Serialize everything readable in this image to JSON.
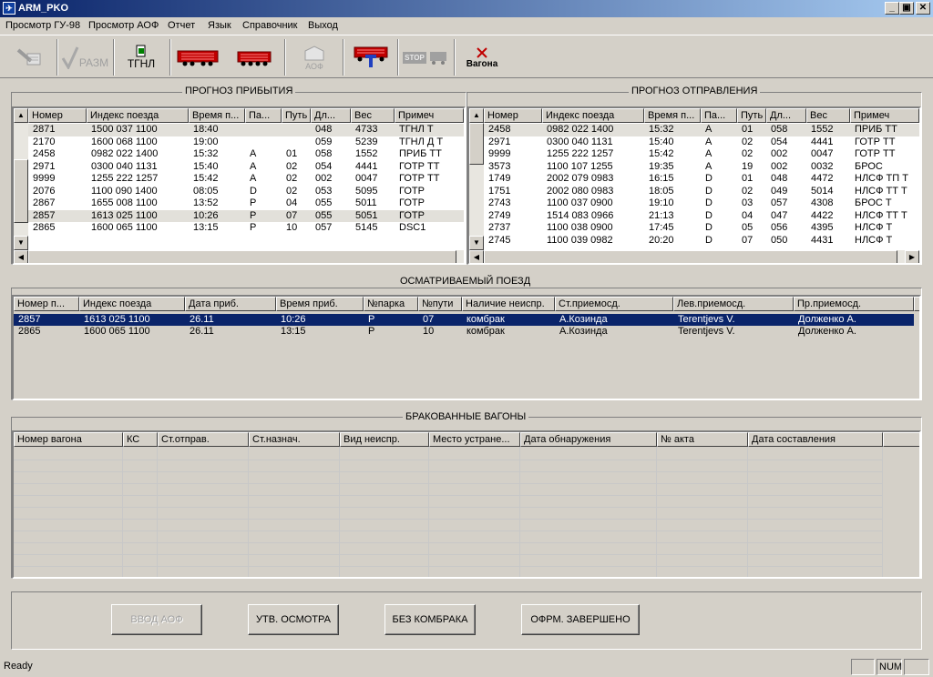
{
  "window": {
    "title": "ARM_PKO",
    "min": "_",
    "max": "▣",
    "close": "✕"
  },
  "menu": [
    "Просмотр ГУ-98",
    "Просмотр АОФ",
    "Отчет",
    "Язык",
    "Справочник",
    "Выход"
  ],
  "toolbar": {
    "razm_label": "РАЗМ",
    "tgnl_label": "ТГНЛ",
    "aof_label": "АОФ",
    "stop_label": "STOP",
    "vagona_label": "Вагона"
  },
  "arrival": {
    "title": "ПРОГНОЗ ПРИБЫТИЯ",
    "headers": [
      "Номер",
      "Индекс поезда",
      "Время п...",
      "Па...",
      "Путь",
      "Дл...",
      "Вес",
      "Примеч"
    ],
    "rows": [
      [
        "2871",
        "1500 037 1100",
        "18:40",
        "",
        "",
        "048",
        "4733",
        "ТГНЛ    Т"
      ],
      [
        "2170",
        "1600 068 1100",
        "19:00",
        "",
        "",
        "059",
        "5239",
        "ТГНЛ    Д Т"
      ],
      [
        "2458",
        "0982 022 1400",
        "15:32",
        "A",
        "01",
        "058",
        "1552",
        "ПРИБ ТТ"
      ],
      [
        "2971",
        "0300 040 1131",
        "15:40",
        "A",
        "02",
        "054",
        "4441",
        "ГОТР ТТ"
      ],
      [
        "9999",
        "1255 222 1257",
        "15:42",
        "A",
        "02",
        "002",
        "0047",
        "ГОТР ТТ"
      ],
      [
        "2076",
        "1100 090 1400",
        "08:05",
        "D",
        "02",
        "053",
        "5095",
        "ГОТР"
      ],
      [
        "2867",
        "1655 008 1100",
        "13:52",
        "P",
        "04",
        "055",
        "5011",
        "ГОТР"
      ],
      [
        "2857",
        "1613 025 1100",
        "10:26",
        "P",
        "07",
        "055",
        "5051",
        "ГОТР"
      ],
      [
        "2865",
        "1600 065 1100",
        "13:15",
        "P",
        "10",
        "057",
        "5145",
        "DSC1"
      ]
    ]
  },
  "departure": {
    "title": "ПРОГНОЗ ОТПРАВЛЕНИЯ",
    "headers": [
      "Номер",
      "Индекс поезда",
      "Время п...",
      "Па...",
      "Путь",
      "Дл...",
      "Вес",
      "Примеч"
    ],
    "rows": [
      [
        "2458",
        "0982 022 1400",
        "15:32",
        "A",
        "01",
        "058",
        "1552",
        "ПРИБ ТТ"
      ],
      [
        "2971",
        "0300 040 1131",
        "15:40",
        "A",
        "02",
        "054",
        "4441",
        "ГОТР ТТ"
      ],
      [
        "9999",
        "1255 222 1257",
        "15:42",
        "A",
        "02",
        "002",
        "0047",
        "ГОТР ТТ"
      ],
      [
        "3573",
        "1100 107 1255",
        "19:35",
        "A",
        "19",
        "002",
        "0032",
        "БРОС"
      ],
      [
        "1749",
        "2002 079 0983",
        "16:15",
        "D",
        "01",
        "048",
        "4472",
        "НЛСФ ТП Т"
      ],
      [
        "1751",
        "2002 080 0983",
        "18:05",
        "D",
        "02",
        "049",
        "5014",
        "НЛСФ ТТ Т"
      ],
      [
        "2743",
        "1100 037 0900",
        "19:10",
        "D",
        "03",
        "057",
        "4308",
        "БРОС    Т"
      ],
      [
        "2749",
        "1514 083 0966",
        "21:13",
        "D",
        "04",
        "047",
        "4422",
        "НЛСФ ТТ Т"
      ],
      [
        "2737",
        "1100 038 0900",
        "17:45",
        "D",
        "05",
        "056",
        "4395",
        "НЛСФ    Т"
      ],
      [
        "2745",
        "1100 039 0982",
        "20:20",
        "D",
        "07",
        "050",
        "4431",
        "НЛСФ    Т"
      ]
    ]
  },
  "inspected": {
    "title": "ОСМАТРИВАЕМЫЙ ПОЕЗД",
    "headers": [
      "Номер п...",
      "Индекс поезда",
      "Дата приб.",
      "Время приб.",
      "№парка",
      "№пути",
      "Наличие неиспр.",
      "Ст.приемосд.",
      "Лев.приемосд.",
      "Пр.приемосд."
    ],
    "rows": [
      [
        "2857",
        "1613 025 1100",
        "26.11",
        "10:26",
        "P",
        "07",
        "комбрак",
        "А.Козинда",
        "Terentjevs V.",
        "Долженко А."
      ],
      [
        "2865",
        "1600 065 1100",
        "26.11",
        "13:15",
        "P",
        "10",
        "комбрак",
        "А.Козинда",
        "Terentjevs V.",
        "Долженко А."
      ]
    ]
  },
  "rejected": {
    "title": "БРАКОВАННЫЕ ВАГОНЫ",
    "headers": [
      "Номер вагона",
      "КС",
      "Ст.отправ.",
      "Ст.назнач.",
      "Вид неиспр.",
      "Место устране...",
      "Дата обнаружения",
      "№ акта",
      "Дата составления"
    ]
  },
  "buttons": {
    "vvod_aof": "ВВОД АОФ",
    "utv_osmotra": "УТВ. ОСМОТРА",
    "bez_kombraka": "БЕЗ КОМБРАКА",
    "ofrm_zaversheno": "ОФРМ. ЗАВЕРШЕНО"
  },
  "status": {
    "text": "Ready",
    "num": "NUM"
  }
}
